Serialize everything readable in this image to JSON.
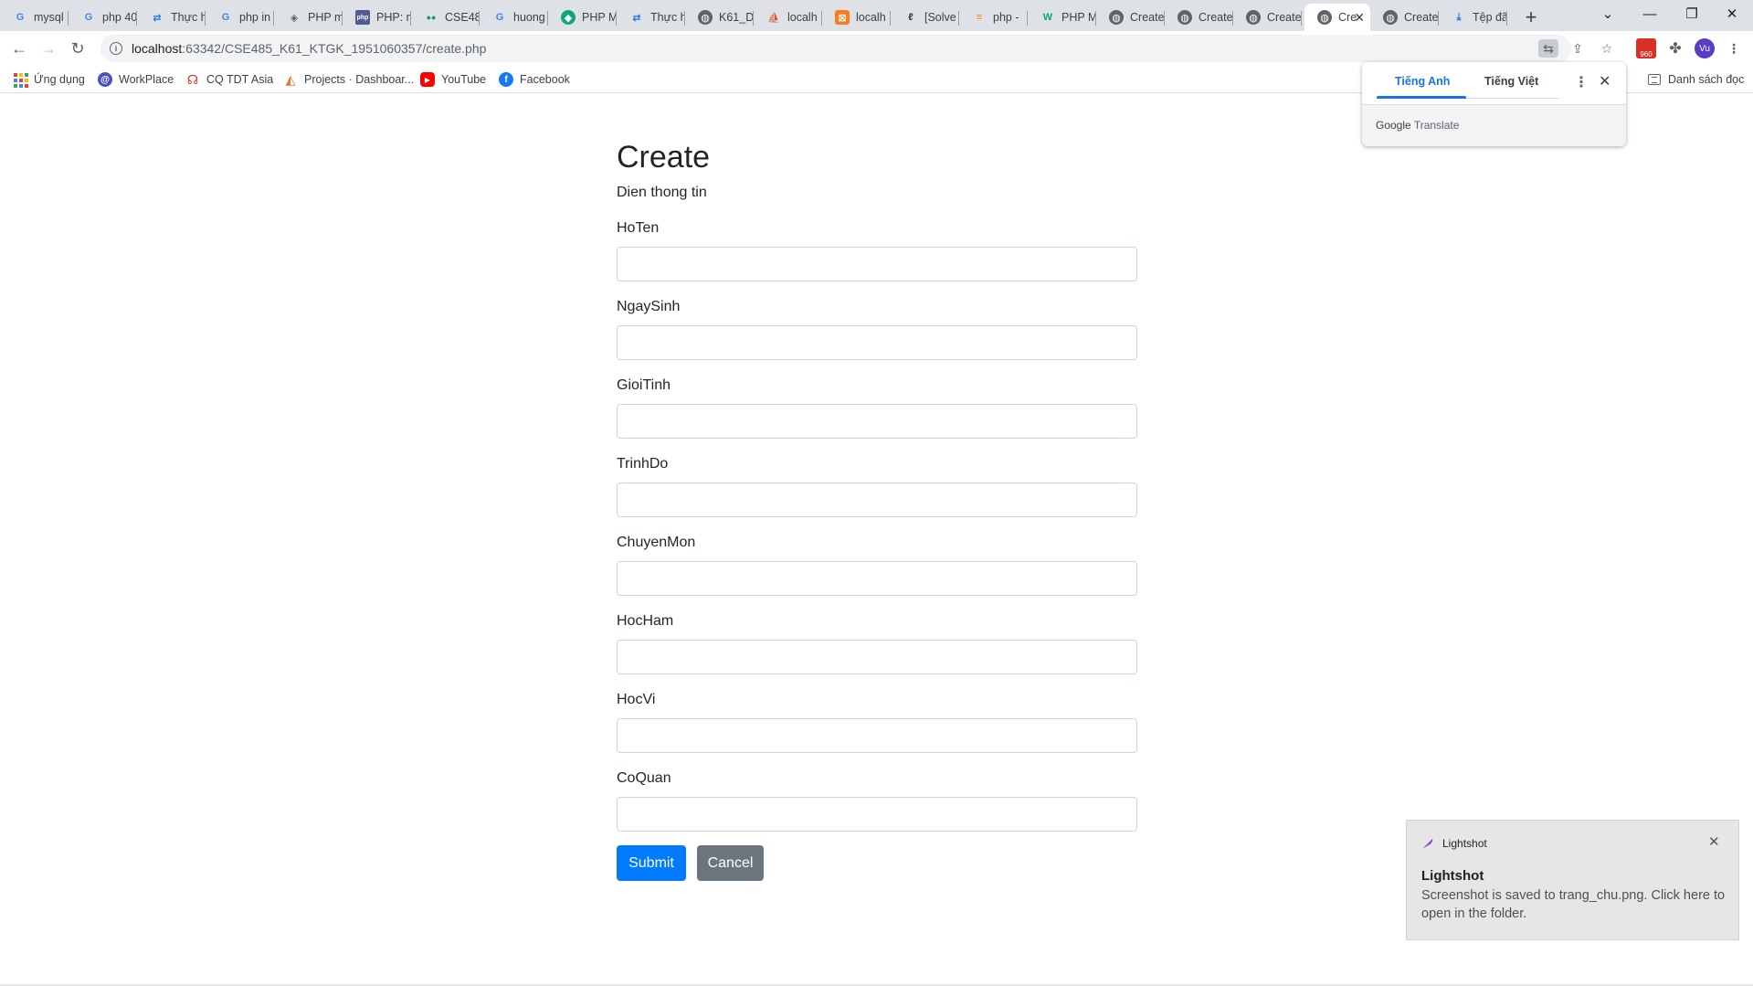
{
  "browser": {
    "tabs": [
      {
        "label": "mysql",
        "icon": "google-icon",
        "color": "#4285f4"
      },
      {
        "label": "php 40",
        "icon": "google-icon",
        "color": "#4285f4"
      },
      {
        "label": "Thực h",
        "icon": "translate-tab-icon",
        "color": "#1a73e8"
      },
      {
        "label": "php in",
        "icon": "google-icon",
        "color": "#4285f4"
      },
      {
        "label": "PHP m",
        "icon": "php-icon",
        "color": "#5f6368"
      },
      {
        "label": "PHP: m",
        "icon": "php-net-icon",
        "color": "#4f5b93"
      },
      {
        "label": "CSE48",
        "icon": "classroom-icon",
        "color": "#0f9d58"
      },
      {
        "label": "huong",
        "icon": "google-icon",
        "color": "#4285f4"
      },
      {
        "label": "PHP M",
        "icon": "shield-tab-icon",
        "color": "#0fa77a"
      },
      {
        "label": "Thực h",
        "icon": "translate-tab-icon",
        "color": "#1a73e8"
      },
      {
        "label": "K61_D",
        "icon": "globe-icon",
        "color": "#5f6368"
      },
      {
        "label": "localh",
        "icon": "phpmyadmin-icon",
        "color": "#f29111"
      },
      {
        "label": "localh",
        "icon": "xampp-icon",
        "color": "#fb7a24"
      },
      {
        "label": "[Solve",
        "icon": "solved-icon",
        "color": "#333333"
      },
      {
        "label": "php -",
        "icon": "stackoverflow-icon",
        "color": "#f48024"
      },
      {
        "label": "PHP M",
        "icon": "w3schools-icon",
        "color": "#04aa6d"
      },
      {
        "label": "Create",
        "icon": "globe-icon",
        "color": "#5f6368"
      },
      {
        "label": "Create",
        "icon": "globe-icon",
        "color": "#5f6368"
      },
      {
        "label": "Create",
        "icon": "globe-icon",
        "color": "#5f6368"
      },
      {
        "label": "Cre",
        "icon": "globe-icon",
        "color": "#5f6368",
        "active": true
      },
      {
        "label": "Create",
        "icon": "globe-icon",
        "color": "#5f6368"
      },
      {
        "label": "Tệp đã",
        "icon": "download-icon",
        "color": "#1a73e8"
      }
    ],
    "url_host": "localhost",
    "url_path": ":63342/CSE485_K61_KTGK_1951060357/create.php",
    "profile_initials": "Vu",
    "extension_badge": "960",
    "bookmarks": [
      {
        "label": "Ứng dụng",
        "icon": "apps-grid-icon"
      },
      {
        "label": "WorkPlace",
        "icon": "workplace-icon",
        "color": "#4b4fbf"
      },
      {
        "label": "CQ TDT Asia",
        "icon": "cq-tdt-icon",
        "color": "#d93025"
      },
      {
        "label": "Projects · Dashboar...",
        "icon": "gitlab-icon",
        "color": "#fc6d26"
      },
      {
        "label": "YouTube",
        "icon": "youtube-icon",
        "color": "#ff0000"
      },
      {
        "label": "Facebook",
        "icon": "facebook-icon",
        "color": "#1877f2"
      }
    ],
    "reading_list": "Danh sách đọc"
  },
  "translate_popup": {
    "tab_source": "Tiếng Anh",
    "tab_target": "Tiếng Việt",
    "brand_google": "Google",
    "brand_translate": "Translate"
  },
  "page": {
    "title": "Create",
    "subtitle": "Dien thong tin",
    "fields": [
      {
        "label": "HoTen",
        "value": ""
      },
      {
        "label": "NgaySinh",
        "value": ""
      },
      {
        "label": "GioiTinh",
        "value": ""
      },
      {
        "label": "TrinhDo",
        "value": ""
      },
      {
        "label": "ChuyenMon",
        "value": ""
      },
      {
        "label": "HocHam",
        "value": ""
      },
      {
        "label": "HocVi",
        "value": ""
      },
      {
        "label": "CoQuan",
        "value": ""
      }
    ],
    "submit_label": "Submit",
    "cancel_label": "Cancel",
    "colors": {
      "primary": "#007bff",
      "secondary": "#6c757d"
    }
  },
  "toast": {
    "app_name": "Lightshot",
    "title": "Lightshot",
    "message": "Screenshot is saved to trang_chu.png. Click here to open in the folder."
  }
}
